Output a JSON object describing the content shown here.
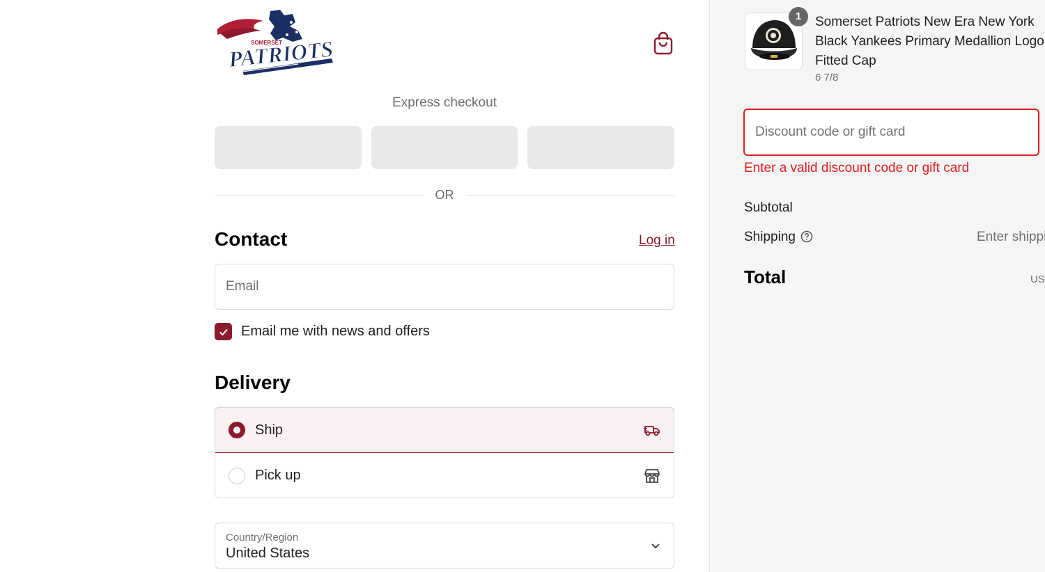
{
  "brand": {
    "logo_small_text": "SOMERSET",
    "logo_text": "PATRIOTS",
    "logo_icon": "somerset-patriots-logo",
    "accent_color": "#8b1a2c",
    "error_color": "#dd1d1d"
  },
  "header": {
    "cart_icon": "shopping-bag-icon"
  },
  "express": {
    "title": "Express checkout",
    "divider": "OR"
  },
  "contact": {
    "title": "Contact",
    "login_link": "Log in",
    "email_placeholder": "Email",
    "newsletter_label": "Email me with news and offers",
    "newsletter_checked": true
  },
  "delivery": {
    "title": "Delivery",
    "options": [
      {
        "label": "Ship",
        "icon": "truck-icon",
        "selected": true
      },
      {
        "label": "Pick up",
        "icon": "store-icon",
        "selected": false
      }
    ],
    "country_label": "Country/Region",
    "country_value": "United States"
  },
  "summary": {
    "product": {
      "name": "Somerset Patriots New Era New York Black Yankees Primary Medallion Logo Fitted Cap",
      "variant": "6 7/8",
      "quantity": "1",
      "image_icon": "fitted-cap-image"
    },
    "discount_placeholder": "Discount code or gift card",
    "discount_error": "Enter a valid discount code or gift card",
    "subtotal_label": "Subtotal",
    "shipping_label": "Shipping",
    "shipping_value": "Enter shippi",
    "total_label": "Total",
    "total_currency": "USI"
  }
}
